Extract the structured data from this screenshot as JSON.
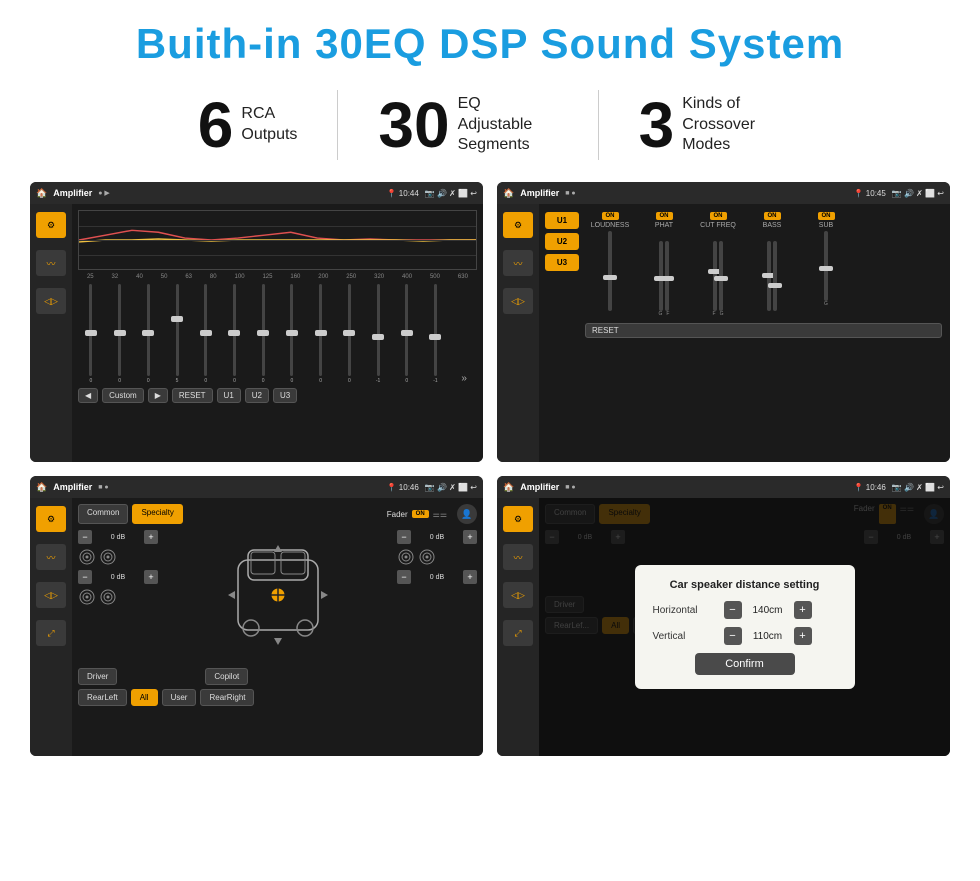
{
  "title": "Buith-in 30EQ DSP Sound System",
  "stats": [
    {
      "number": "6",
      "label": "RCA\nOutputs"
    },
    {
      "number": "30",
      "label": "EQ Adjustable\nSegments"
    },
    {
      "number": "3",
      "label": "Kinds of\nCrossover Modes"
    }
  ],
  "screens": [
    {
      "id": "eq-screen",
      "topbar": {
        "icon": "🏠",
        "title": "Amplifier",
        "time": "10:44",
        "controls": [
          "📷",
          "🔊",
          "✗",
          "⬜",
          "↩"
        ]
      },
      "type": "equalizer"
    },
    {
      "id": "amp2-screen",
      "topbar": {
        "icon": "🏠",
        "title": "Amplifier",
        "time": "10:45",
        "controls": [
          "📷",
          "🔊",
          "✗",
          "⬜",
          "↩"
        ]
      },
      "type": "amplifier2"
    },
    {
      "id": "fader-screen",
      "topbar": {
        "icon": "🏠",
        "title": "Amplifier",
        "time": "10:46",
        "controls": [
          "📷",
          "🔊",
          "✗",
          "⬜",
          "↩"
        ]
      },
      "type": "fader"
    },
    {
      "id": "dialog-screen",
      "topbar": {
        "icon": "🏠",
        "title": "Amplifier",
        "time": "10:46",
        "controls": [
          "📷",
          "🔊",
          "✗",
          "⬜",
          "↩"
        ]
      },
      "type": "dialog"
    }
  ],
  "dialog": {
    "title": "Car speaker distance setting",
    "horizontal_label": "Horizontal",
    "horizontal_value": "140cm",
    "vertical_label": "Vertical",
    "vertical_value": "110cm",
    "confirm_label": "Confirm"
  },
  "eq": {
    "frequencies": [
      "25",
      "32",
      "40",
      "50",
      "63",
      "80",
      "100",
      "125",
      "160",
      "200",
      "250",
      "320",
      "400",
      "500",
      "630"
    ],
    "values": [
      "0",
      "0",
      "0",
      "5",
      "0",
      "0",
      "0",
      "0",
      "0",
      "0",
      "-1",
      "0",
      "-1"
    ],
    "buttons": [
      "Custom",
      "RESET",
      "U1",
      "U2",
      "U3"
    ]
  },
  "amp2": {
    "presets": [
      "U1",
      "U2",
      "U3"
    ],
    "channels": [
      "LOUDNESS",
      "PHAT",
      "CUT FREQ",
      "BASS",
      "SUB"
    ],
    "reset_label": "RESET"
  },
  "fader": {
    "tabs": [
      "Common",
      "Specialty"
    ],
    "fader_label": "Fader",
    "on_label": "ON",
    "db_values": [
      "0 dB",
      "0 dB",
      "0 dB",
      "0 dB"
    ],
    "bottom_btns": [
      "Driver",
      "RearLeft",
      "All",
      "User",
      "RearRight",
      "Copilot"
    ]
  }
}
